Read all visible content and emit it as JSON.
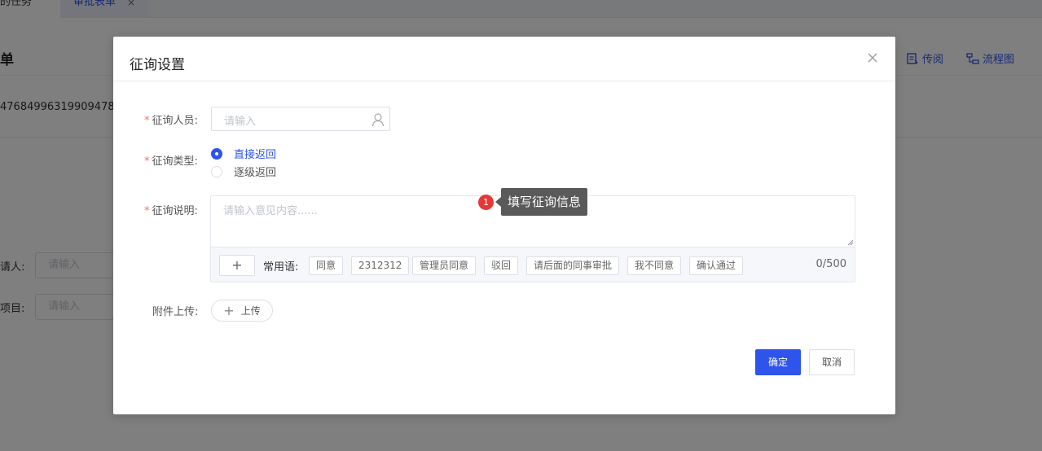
{
  "background": {
    "tabs": [
      {
        "label": "的任务"
      },
      {
        "label": "审批表单",
        "close": "×"
      }
    ],
    "page_title": "单",
    "toolbar": [
      {
        "label": "传阅",
        "icon": "list-icon"
      },
      {
        "label": "流程图",
        "icon": "flow-icon"
      }
    ],
    "id_text": "47684996319909478",
    "fields": [
      {
        "label": "请人:",
        "placeholder": "请输入"
      },
      {
        "label": "项目:",
        "placeholder": "请输入"
      }
    ]
  },
  "dialog": {
    "title": "征询设置",
    "person": {
      "label": "征询人员:",
      "placeholder": "请输入"
    },
    "type": {
      "label": "征询类型:",
      "options": [
        {
          "label": "直接返回",
          "selected": true
        },
        {
          "label": "逐级返回",
          "selected": false
        }
      ]
    },
    "desc": {
      "label": "征询说明:",
      "placeholder": "请输入意见内容......",
      "add_symbol": "+",
      "phrases_label": "常用语:",
      "phrases": [
        "同意",
        "2312312",
        "管理员同意",
        "驳回",
        "请后面的同事审批",
        "我不同意",
        "确认通过"
      ],
      "counter": "0/500"
    },
    "attachment": {
      "label": "附件上传:",
      "button": "上传",
      "plus": "+"
    },
    "ok": "确定",
    "cancel": "取消"
  },
  "tooltip": {
    "number": "1",
    "text": "填写征询信息"
  },
  "colors": {
    "primary": "#2f54eb",
    "required": "#f56c6c",
    "badge": "#e53935"
  }
}
